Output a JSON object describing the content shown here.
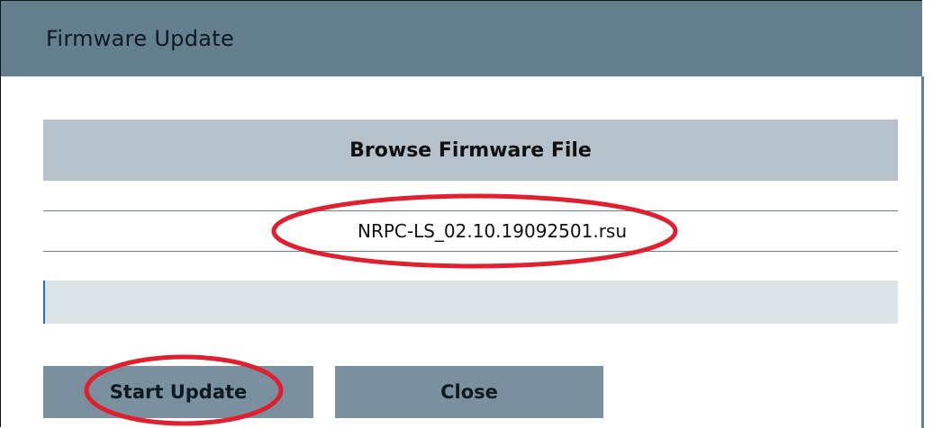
{
  "dialog": {
    "title": "Firmware Update"
  },
  "browse": {
    "label": "Browse Firmware File"
  },
  "file": {
    "name": "NRPC-LS_02.10.19092501.rsu"
  },
  "progress": {
    "value": 0.002
  },
  "actions": {
    "start_label": "Start Update",
    "close_label": "Close"
  },
  "colors": {
    "titlebar": "#64808f",
    "primary_button": "#b6c2cb",
    "action_button": "#7b909e",
    "progress_track": "#dce4e7",
    "annotation": "#e0202e"
  }
}
